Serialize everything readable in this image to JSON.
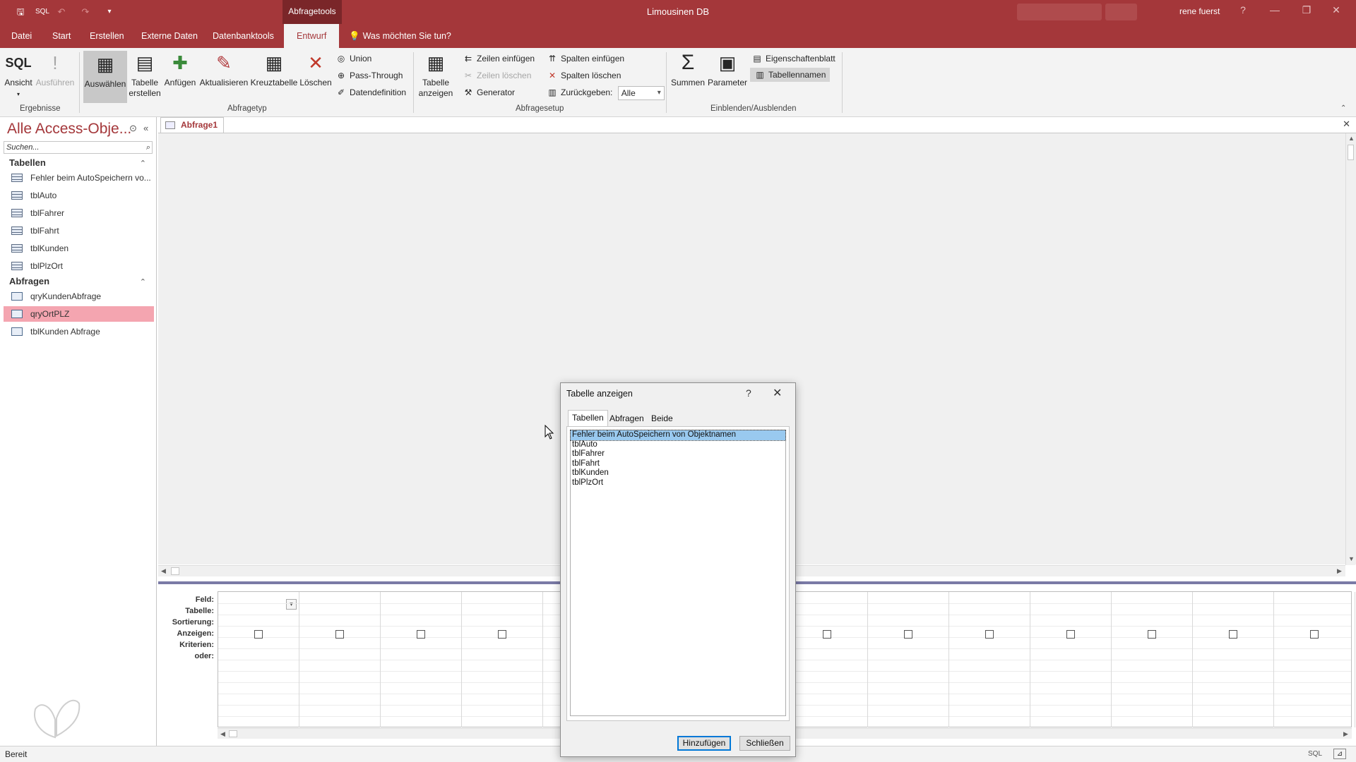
{
  "titlebar": {
    "context_label": "Abfragetools",
    "app_title": "Limousinen DB",
    "user": "rene fuerst",
    "help_glyph": "?",
    "minimize_glyph": "—",
    "restore_glyph": "❐",
    "close_glyph": "✕",
    "save_glyph": "🖫",
    "sql_label": "SQL",
    "undo_glyph": "↶",
    "redo_glyph": "↷",
    "qat_glyph": "▾"
  },
  "menu": {
    "items": [
      "Datei",
      "Start",
      "Erstellen",
      "Externe Daten",
      "Datenbanktools",
      "Entwurf"
    ],
    "active": "Entwurf",
    "tell_me": "Was möchten Sie tun?"
  },
  "ribbon": {
    "ergebnisse": {
      "label": "Ergebnisse",
      "ansicht": "Ansicht",
      "ansicht_icon": "SQL",
      "ausfuehren": "Ausführen"
    },
    "abfragetyp": {
      "label": "Abfragetyp",
      "auswaehlen": "Auswählen",
      "tabelle_erstellen_1": "Tabelle",
      "tabelle_erstellen_2": "erstellen",
      "anfuegen": "Anfügen",
      "aktualisieren": "Aktualisieren",
      "kreuztabelle": "Kreuztabelle",
      "loeschen": "Löschen",
      "union": "Union",
      "pass_through": "Pass-Through",
      "datendefinition": "Datendefinition"
    },
    "abfragesetup": {
      "label": "Abfragesetup",
      "tabelle_anzeigen_1": "Tabelle",
      "tabelle_anzeigen_2": "anzeigen",
      "zeilen_einfuegen": "Zeilen einfügen",
      "zeilen_loeschen": "Zeilen löschen",
      "generator": "Generator",
      "spalten_einfuegen": "Spalten einfügen",
      "spalten_loeschen": "Spalten löschen",
      "zurueckgeben": "Zurückgeben:",
      "zurueckgeben_value": "Alle"
    },
    "einblenden": {
      "label": "Einblenden/Ausblenden",
      "summen": "Summen",
      "summen_icon": "Σ",
      "parameter": "Parameter",
      "eigenschaftenblatt": "Eigenschaftenblatt",
      "tabellennamen": "Tabellennamen"
    }
  },
  "nav": {
    "title": "Alle Access-Obje...",
    "search_placeholder": "Suchen...",
    "tables_header": "Tabellen",
    "tables": [
      "Fehler beim AutoSpeichern vo...",
      "tblAuto",
      "tblFahrer",
      "tblFahrt",
      "tblKunden",
      "tblPlzOrt"
    ],
    "queries_header": "Abfragen",
    "queries": [
      "qryKundenAbfrage",
      "qryOrtPLZ",
      "tblKunden Abfrage"
    ],
    "selected_query": "qryOrtPLZ"
  },
  "document": {
    "tab_label": "Abfrage1"
  },
  "grid": {
    "row_labels": [
      "Feld:",
      "Tabelle:",
      "Sortierung:",
      "Anzeigen:",
      "Kriterien:",
      "oder:"
    ]
  },
  "dialog": {
    "title": "Tabelle anzeigen",
    "help": "?",
    "close": "✕",
    "tabs": [
      "Tabellen",
      "Abfragen",
      "Beide"
    ],
    "active_tab": "Tabellen",
    "items": [
      "Fehler beim AutoSpeichern von Objektnamen",
      "tblAuto",
      "tblFahrer",
      "tblFahrt",
      "tblKunden",
      "tblPlzOrt"
    ],
    "selected_item": "Fehler beim AutoSpeichern von Objektnamen",
    "add_button": "Hinzufügen",
    "close_button": "Schließen"
  },
  "status": {
    "text": "Bereit",
    "view_sql": "SQL"
  },
  "colors": {
    "accent": "#a4373a",
    "selection_nav": "#f4a5b0",
    "selection_list": "#99c9ef"
  }
}
